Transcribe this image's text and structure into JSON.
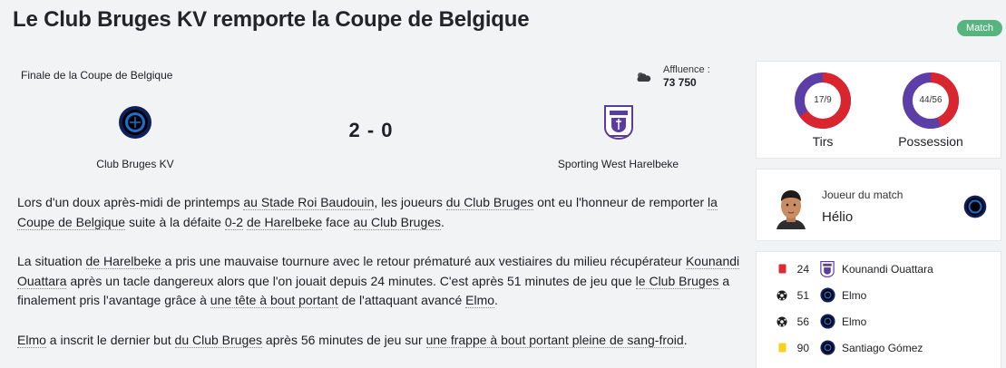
{
  "page": {
    "title": "Le Club Bruges KV remporte la Coupe de Belgique",
    "tag": "Match"
  },
  "match": {
    "competition": "Finale de la Coupe de Belgique",
    "attendance_label": "Affluence :",
    "attendance_value": "73 750",
    "weather_icon": "cloud-sun-icon",
    "home_team": "Club Bruges KV",
    "away_team": "Sporting West Harelbeke",
    "score": "2 - 0",
    "colors": {
      "home": "#0d1f5c",
      "away": "#5a3c9c"
    }
  },
  "report": {
    "p1": [
      "Lors d'un doux après-midi de printemps ",
      "au Stade Roi Baudouin",
      ", les joueurs ",
      "du Club Bruges",
      " ont eu l'honneur de remporter ",
      "la Coupe de Belgique",
      " suite à la défaite ",
      "0-2",
      " ",
      "de Harelbeke",
      " face ",
      "au Club Bruges",
      "."
    ],
    "p2": [
      "La situation ",
      "de Harelbeke",
      " a pris une mauvaise tournure avec le retour prématuré aux vestiaires du milieu récupérateur ",
      "Kounandi Ouattara",
      " après un tacle dangereux alors que l'on jouait depuis 24 minutes. C'est après 51 minutes de jeu que ",
      "le Club Bruges",
      " a finalement pris l'avantage grâce à ",
      "une tête à bout portant",
      " de l'attaquant avancé ",
      "Elmo",
      "."
    ],
    "p3": [
      "Elmo",
      " a inscrit le dernier but ",
      "du Club Bruges",
      " après 56 minutes de jeu sur ",
      "une frappe à bout portant pleine de sang-froid",
      "."
    ]
  },
  "stats": {
    "shots": {
      "label": "Tirs",
      "text": "17/9",
      "home": 17,
      "away": 9
    },
    "possession": {
      "label": "Possession",
      "text": "44/56",
      "home": 44,
      "away": 56
    },
    "colors": {
      "home": "#d9262e",
      "away": "#5b3ea6"
    }
  },
  "motm": {
    "label": "Joueur du match",
    "name": "Hélio"
  },
  "events": [
    {
      "icon": "red-card-icon",
      "minute": "24",
      "club": "harelbeke",
      "player": "Kounandi Ouattara"
    },
    {
      "icon": "ball-icon",
      "minute": "51",
      "club": "bruges",
      "player": "Elmo"
    },
    {
      "icon": "ball-icon",
      "minute": "56",
      "club": "bruges",
      "player": "Elmo"
    },
    {
      "icon": "yellow-card-icon",
      "minute": "90",
      "club": "bruges",
      "player": "Santiago Gómez"
    }
  ]
}
